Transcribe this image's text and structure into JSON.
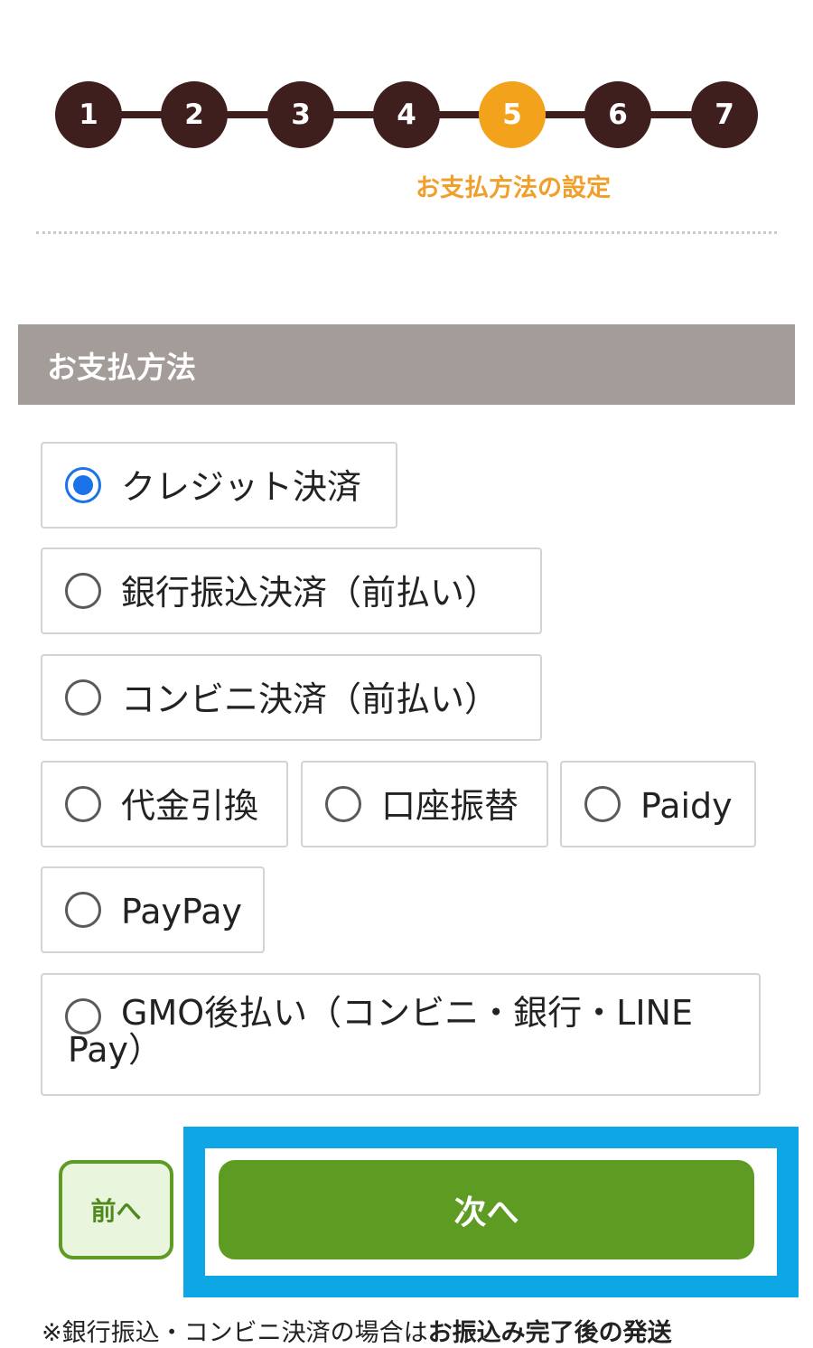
{
  "stepper": {
    "steps": [
      "1",
      "2",
      "3",
      "4",
      "5",
      "6",
      "7"
    ],
    "active_step": "5",
    "active_caption": "お支払方法の設定",
    "colors": {
      "inactive": "#3f1e1e",
      "active": "#f3a21c"
    }
  },
  "section": {
    "title": "お支払方法"
  },
  "payment_options": [
    {
      "label": "クレジット決済",
      "selected": true
    },
    {
      "label": "銀行振込決済（前払い）",
      "selected": false
    },
    {
      "label": "コンビニ決済（前払い）",
      "selected": false
    },
    {
      "label": "代金引換",
      "selected": false
    },
    {
      "label": "口座振替",
      "selected": false
    },
    {
      "label": "Paidy",
      "selected": false
    },
    {
      "label": "PayPay",
      "selected": false
    },
    {
      "label": "GMO後払い（コンビニ・銀行・LINE Pay）",
      "selected": false
    }
  ],
  "buttons": {
    "prev_label": "前へ",
    "next_label": "次へ",
    "accent_color": "#5e9b23",
    "highlight_color": "#0fa6e6"
  },
  "footnote": {
    "text": "※銀行振込・コンビニ決済の場合は",
    "emphasis": "お振込み完了後の発送"
  }
}
